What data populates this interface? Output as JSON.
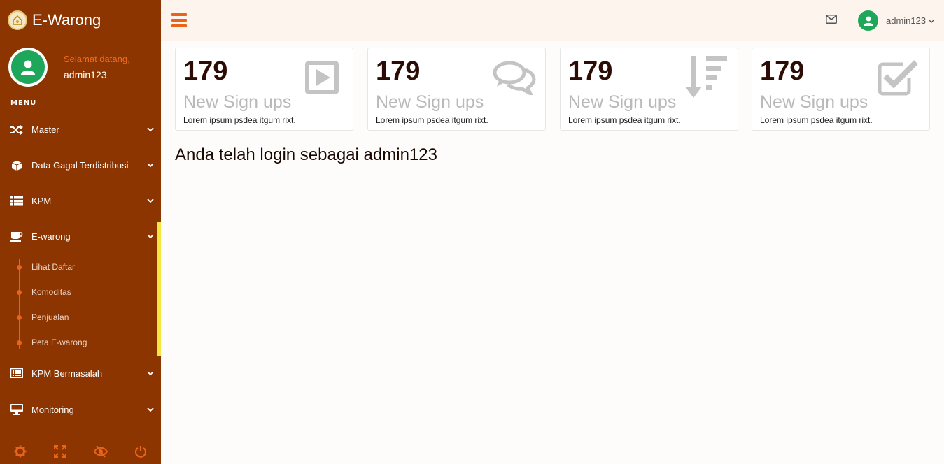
{
  "brand": {
    "title": "E-Warong"
  },
  "profile": {
    "greeting": "Selamat datang,",
    "username": "admin123"
  },
  "menu": {
    "heading": "MENU",
    "items": [
      {
        "label": "Master",
        "icon": "shuffle-icon"
      },
      {
        "label": "Data Gagal Terdistribusi",
        "icon": "cube-icon"
      },
      {
        "label": "KPM",
        "icon": "list-icon"
      },
      {
        "label": "E-warong",
        "icon": "coffee-icon",
        "active": true
      },
      {
        "label": "KPM Bermasalah",
        "icon": "list-alt-icon"
      },
      {
        "label": "Monitoring",
        "icon": "desktop-icon"
      }
    ],
    "submenu": [
      "Lihat Daftar",
      "Komoditas",
      "Penjualan",
      "Peta E-warong"
    ]
  },
  "footer_icons": [
    "gear-icon",
    "fullscreen-icon",
    "eye-slash-icon",
    "power-icon"
  ],
  "topbar": {
    "user": "admin123"
  },
  "cards": [
    {
      "number": "179",
      "title": "New Sign ups",
      "desc": "Lorem ipsum psdea itgum rixt.",
      "icon": "play-icon"
    },
    {
      "number": "179",
      "title": "New Sign ups",
      "desc": "Lorem ipsum psdea itgum rixt.",
      "icon": "comments-icon"
    },
    {
      "number": "179",
      "title": "New Sign ups",
      "desc": "Lorem ipsum psdea itgum rixt.",
      "icon": "sort-amount-down-icon"
    },
    {
      "number": "179",
      "title": "New Sign ups",
      "desc": "Lorem ipsum psdea itgum rixt.",
      "icon": "check-square-icon"
    }
  ],
  "main": {
    "welcome": "Anda telah login sebagai admin123"
  },
  "colors": {
    "sidebar": "#8c3500",
    "accent": "#e8641a",
    "active_bar": "#f5e640",
    "avatar": "#1ea65a"
  }
}
